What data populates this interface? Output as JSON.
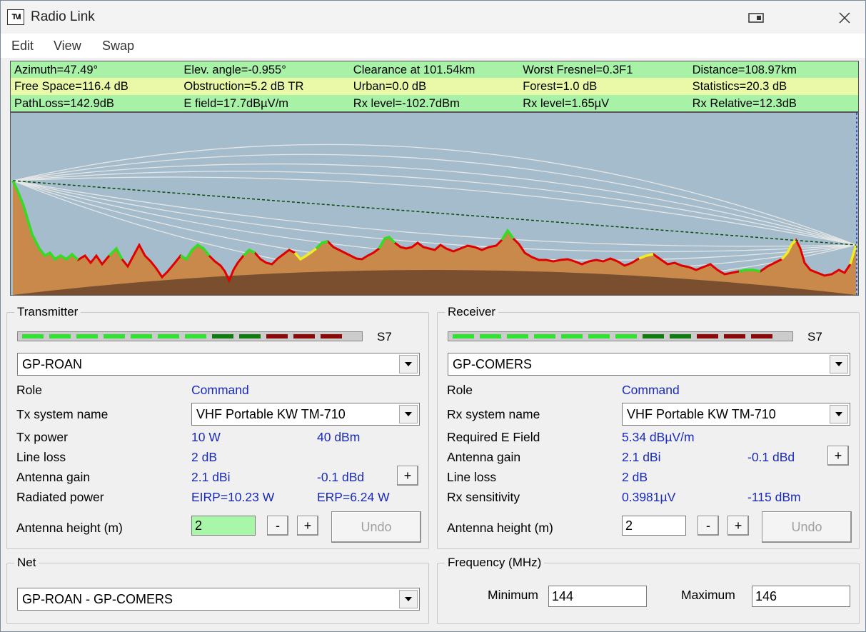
{
  "window": {
    "title": "Radio Link",
    "app_icon_text": "TVI"
  },
  "menu": {
    "items": [
      "Edit",
      "View",
      "Swap"
    ]
  },
  "stats": {
    "rows": [
      [
        "Azimuth=47.49°",
        "Elev. angle=-0.955°",
        "Clearance at 101.54km",
        "Worst Fresnel=0.3F1",
        "Distance=108.97km"
      ],
      [
        "Free Space=116.4 dB",
        "Obstruction=5.2 dB TR",
        "Urban=0.0 dB",
        "Forest=1.0 dB",
        "Statistics=20.3 dB"
      ],
      [
        "PathLoss=142.9dB",
        "E field=17.7dBµV/m",
        "Rx level=-102.7dBm",
        "Rx level=1.65µV",
        "Rx Relative=12.3dB"
      ]
    ]
  },
  "colors": {
    "sky": "#a4bccb",
    "terrain": "#c9894a",
    "earth_curve": "#7a4f30",
    "fresnel": "#e6e6e6",
    "los_line": "#0a4a0a",
    "meter_green": "#33e033",
    "meter_dark_green": "#117a11",
    "meter_red": "#8a0a0a"
  },
  "transmitter": {
    "group_label": "Transmitter",
    "meter_label": "S7",
    "meter_segments": [
      "green",
      "green",
      "green",
      "green",
      "green",
      "green",
      "green",
      "dark-green",
      "dark-green",
      "red",
      "red",
      "red"
    ],
    "station": "GP-ROAN",
    "role_label": "Role",
    "role_value": "Command",
    "system_label": "Tx system name",
    "system_value": "VHF Portable KW TM-710",
    "power_label": "Tx power",
    "power_w": "10 W",
    "power_dbm": "40 dBm",
    "line_loss_label": "Line loss",
    "line_loss_value": "2 dB",
    "gain_label": "Antenna gain",
    "gain_dbi": "2.1 dBi",
    "gain_dbd": "-0.1 dBd",
    "radiated_label": "Radiated power",
    "eirp": "EIRP=10.23 W",
    "erp": "ERP=6.24 W",
    "height_label": "Antenna height (m)",
    "height_value": "2",
    "minus": "-",
    "plus": "+",
    "undo": "Undo"
  },
  "receiver": {
    "group_label": "Receiver",
    "meter_label": "S7",
    "meter_segments": [
      "green",
      "green",
      "green",
      "green",
      "green",
      "green",
      "green",
      "dark-green",
      "dark-green",
      "red",
      "red",
      "red"
    ],
    "station": "GP-COMERS",
    "role_label": "Role",
    "role_value": "Command",
    "system_label": "Rx system name",
    "system_value": "VHF Portable KW TM-710",
    "field_label": "Required E Field",
    "field_value": "5.34 dBµV/m",
    "gain_label": "Antenna gain",
    "gain_dbi": "2.1 dBi",
    "gain_dbd": "-0.1 dBd",
    "line_loss_label": "Line loss",
    "line_loss_value": "2 dB",
    "sens_label": "Rx sensitivity",
    "sens_uv": "0.3981µV",
    "sens_dbm": "-115 dBm",
    "height_label": "Antenna height (m)",
    "height_value": "2",
    "minus": "-",
    "plus": "+",
    "undo": "Undo"
  },
  "net": {
    "group_label": "Net",
    "value": "GP-ROAN - GP-COMERS"
  },
  "frequency": {
    "group_label": "Frequency (MHz)",
    "min_label": "Minimum",
    "min_value": "144",
    "max_label": "Maximum",
    "max_value": "146"
  }
}
